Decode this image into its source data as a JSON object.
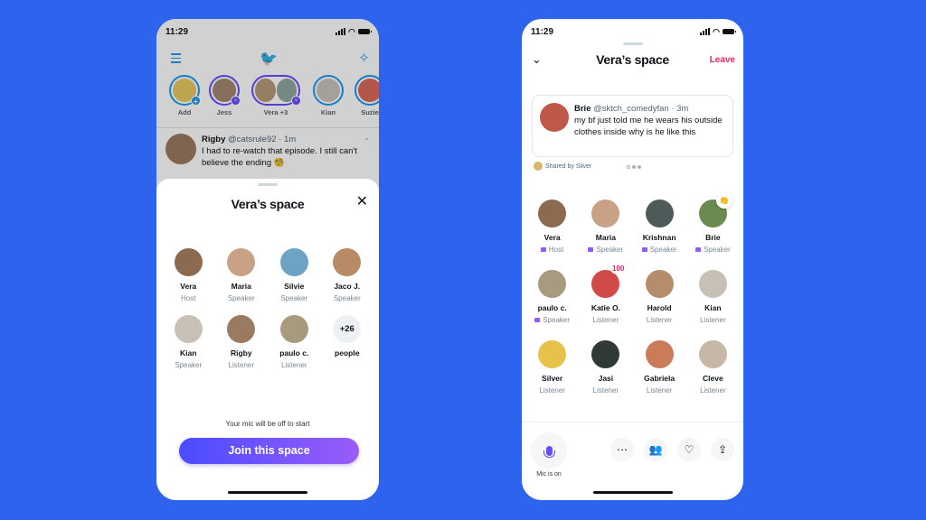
{
  "left_phone": {
    "status_time": "11:29",
    "header": {
      "menu_icon": "hamburger-icon",
      "logo_icon": "twitter-bird-icon",
      "sparkle_icon": "sparkle-icon"
    },
    "fleets": [
      {
        "label": "Add",
        "badge": "+"
      },
      {
        "label": "Jess"
      },
      {
        "label": "Vera +3"
      },
      {
        "label": "Kian"
      },
      {
        "label": "Suzie"
      }
    ],
    "tweet": {
      "name": "Rigby",
      "handle": "@catsrule92 · 1m",
      "text": "I had to re-watch that episode. I still can't believe the ending 🧐"
    },
    "sheet": {
      "title": "Vera’s space",
      "participants": [
        {
          "name": "Vera",
          "role": "Host"
        },
        {
          "name": "Maria",
          "role": "Speaker"
        },
        {
          "name": "Silvie",
          "role": "Speaker"
        },
        {
          "name": "Jaco J.",
          "role": "Speaker"
        },
        {
          "name": "Kian",
          "role": "Speaker"
        },
        {
          "name": "Rigby",
          "role": "Listener"
        },
        {
          "name": "paulo c.",
          "role": "Listener"
        }
      ],
      "more_count": "+26",
      "more_label": "people",
      "mic_note": "Your mic will be off to start",
      "join_label": "Join this space"
    }
  },
  "right_phone": {
    "status_time": "11:29",
    "title": "Vera’s space",
    "leave_label": "Leave",
    "shared_tweet": {
      "name": "Brie",
      "handle": "@sktch_comedyfan · 3m",
      "text": "my bf just told me he wears his outside clothes inside why is he like this"
    },
    "shared_by": "Shared by Silver",
    "participants": [
      {
        "name": "Vera",
        "role": "Host",
        "speaking": true
      },
      {
        "name": "Maria",
        "role": "Speaker",
        "speaking": true
      },
      {
        "name": "Krishnan",
        "role": "Speaker",
        "speaking": true
      },
      {
        "name": "Brie",
        "role": "Speaker",
        "speaking": true,
        "reaction": "👏"
      },
      {
        "name": "paulo c.",
        "role": "Speaker",
        "speaking": true
      },
      {
        "name": "Katie O.",
        "role": "Listener",
        "reaction": "100"
      },
      {
        "name": "Harold",
        "role": "Listener"
      },
      {
        "name": "Kian",
        "role": "Listener"
      },
      {
        "name": "Silver",
        "role": "Listener"
      },
      {
        "name": "Jasi",
        "role": "Listener"
      },
      {
        "name": "Gabriela",
        "role": "Listener"
      },
      {
        "name": "Cleve",
        "role": "Listener"
      }
    ],
    "mic_label": "Mic is on",
    "actions": [
      "more-icon",
      "people-icon",
      "heart-add-icon",
      "share-icon"
    ]
  },
  "colors": {
    "background": "#2d63ed",
    "accent": "#6b4bff",
    "leave": "#f4245e",
    "twitter_blue": "#1d9bf0"
  }
}
